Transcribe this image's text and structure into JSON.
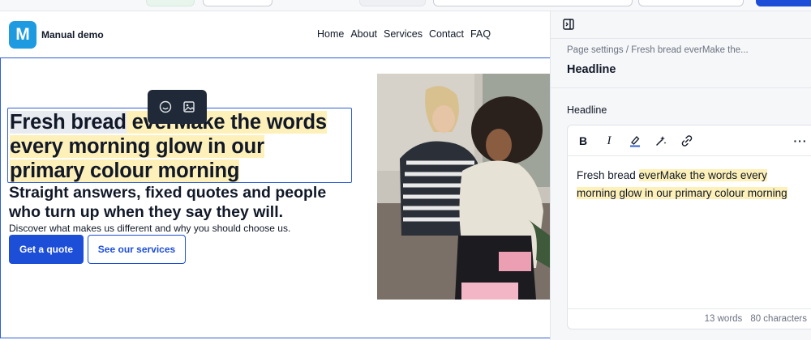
{
  "site": {
    "logo_letter": "M",
    "brand": "Manual demo",
    "nav": [
      "Home",
      "About",
      "Services",
      "Contact",
      "FAQ"
    ]
  },
  "hero": {
    "headline_selected": "Fresh bread",
    "headline_space": " ",
    "headline_rest_l1": "everMake the words",
    "headline_l2": "every morning glow in our",
    "headline_l3": "primary colour morning",
    "subheadline": "Straight answers, fixed quotes and people who turn up when they say they will.",
    "description": "Discover what makes us different and why you should choose us.",
    "primary_cta": "Get a quote",
    "secondary_cta": "See our services"
  },
  "floating_toolbar": {
    "icons": [
      "emoji-icon",
      "image-icon"
    ]
  },
  "panel": {
    "breadcrumb": "Page settings / Fresh bread everMake the...",
    "title": "Headline",
    "field_label": "Headline",
    "toolbar": {
      "bold": "B",
      "italic": "I",
      "more": "···",
      "icons": [
        "highlight-icon",
        "ai-sparkle-icon",
        "link-icon"
      ]
    },
    "editor_plain": "Fresh bread ",
    "editor_highlight": "everMake the words every morning glow in our primary colour morning",
    "word_count": "13 words",
    "char_count": "80 characters"
  },
  "colors": {
    "accent": "#1d4ed8",
    "logo": "#1e9be0",
    "highlight": "#fdf0b8",
    "selection_border": "#2f5fd6"
  }
}
